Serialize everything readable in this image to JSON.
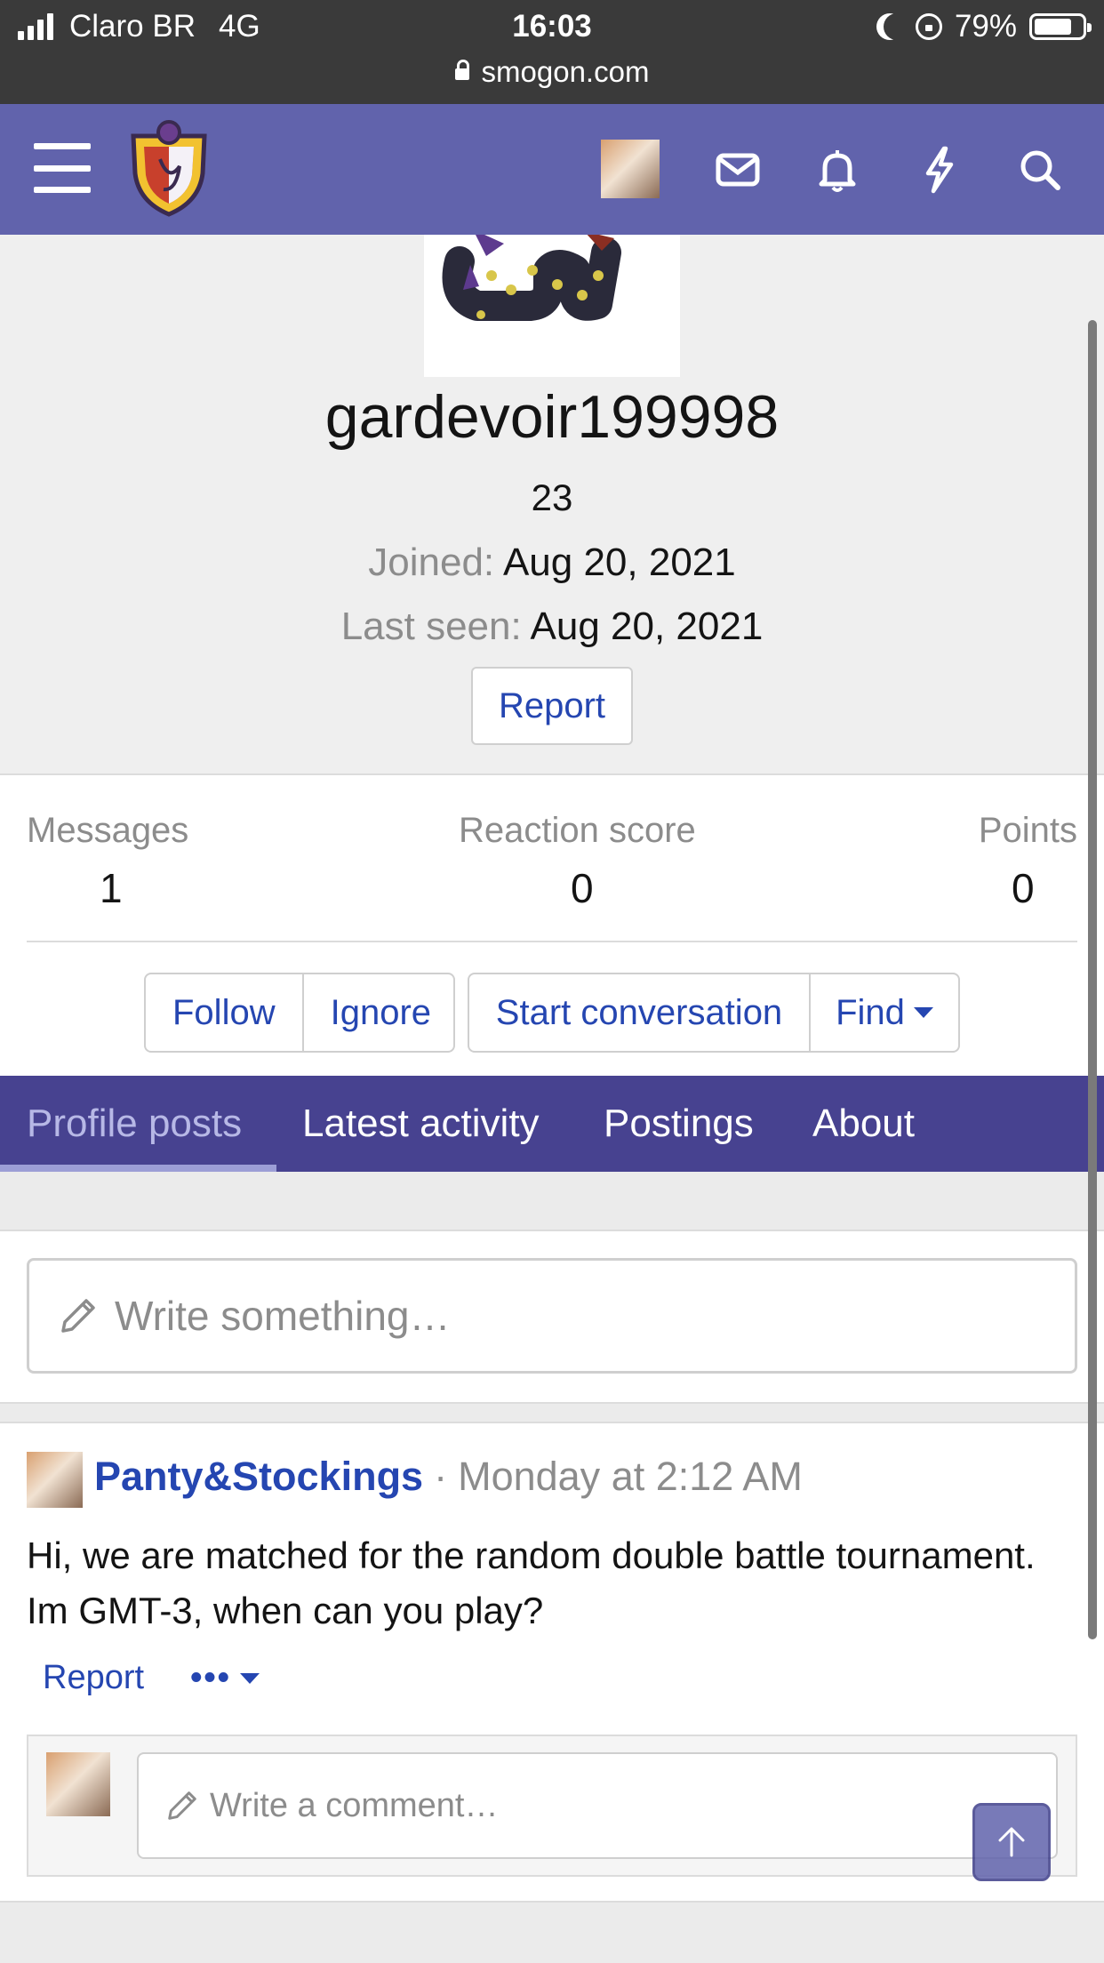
{
  "status_bar": {
    "carrier": "Claro BR",
    "network": "4G",
    "time": "16:03",
    "url": "smogon.com",
    "battery": "79%",
    "battery_level": 0.79
  },
  "nav": {
    "icons": [
      "menu-icon",
      "site-logo",
      "user-avatar",
      "envelope-icon",
      "bell-icon",
      "lightning-icon",
      "search-icon"
    ],
    "colors": {
      "bar": "#6163ac",
      "tabs": "#474290",
      "link": "#2546b1"
    }
  },
  "profile": {
    "username": "gardevoir199998",
    "age": "23",
    "joined_label": "Joined:",
    "joined_value": "Aug 20, 2021",
    "last_seen_label": "Last seen:",
    "last_seen_value": "Aug 20, 2021",
    "report_label": "Report"
  },
  "stats": {
    "messages_label": "Messages",
    "messages_value": "1",
    "reaction_label": "Reaction score",
    "reaction_value": "0",
    "points_label": "Points",
    "points_value": "0"
  },
  "actions": {
    "follow": "Follow",
    "ignore": "Ignore",
    "start_conversation": "Start conversation",
    "find": "Find"
  },
  "tabs": [
    {
      "label": "Profile posts",
      "active": true
    },
    {
      "label": "Latest activity",
      "active": false
    },
    {
      "label": "Postings",
      "active": false
    },
    {
      "label": "About",
      "active": false
    }
  ],
  "composer": {
    "placeholder": "Write something…"
  },
  "post": {
    "author": "Panty&Stockings",
    "separator": "·",
    "time": "Monday at 2:12 AM",
    "body": "Hi, we are matched for the random double battle tournament. Im GMT-3, when can you play?",
    "report_label": "Report",
    "more_label": "•••",
    "comment_placeholder": "Write a comment…"
  }
}
